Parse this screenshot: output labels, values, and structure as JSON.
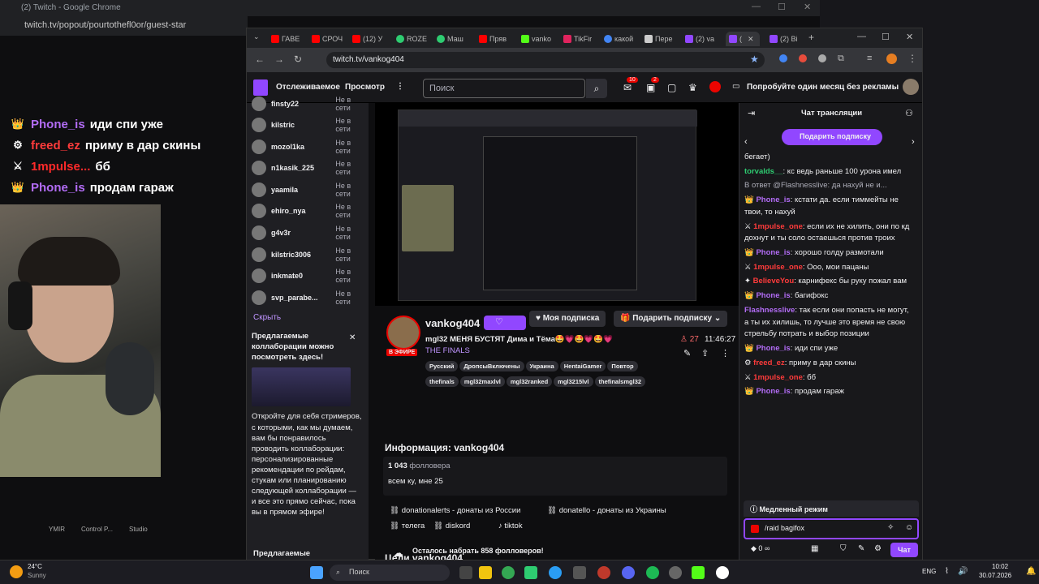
{
  "left_window": {
    "title": "(2) Twitch - Google Chrome",
    "url": "twitch.tv/popout/pourtothefl0or/guest-star"
  },
  "overlay_chat": [
    {
      "user": "Phone_is",
      "text": "иди спи уже",
      "color": "#b26cf5",
      "badge": "👑"
    },
    {
      "user": "freed_ez",
      "text": "приму в дар скины",
      "color": "#ff3b3b",
      "badge": "⚙"
    },
    {
      "user": "1mpulse...",
      "text": "бб",
      "color": "#ff2a2a",
      "badge": "⚔"
    },
    {
      "user": "Phone_is",
      "text": "продам гараж",
      "color": "#b26cf5",
      "badge": "👑"
    }
  ],
  "left_taskbar_labels": [
    "YMIR",
    "Control P...",
    "Studio"
  ],
  "chrome": {
    "tabs": [
      "ГАВЕ",
      "СРОЧ",
      "(12) У",
      "ROZE",
      "Маш",
      "Пряв",
      "vanko",
      "TikFir",
      "какой",
      "Пере",
      "(2) va",
      "(",
      "(2) Bi"
    ],
    "url": "twitch.tv/vankog404"
  },
  "twitch_nav": {
    "following": "Отслеживаемое",
    "browse": "Просмотр",
    "search_placeholder": "Поиск",
    "notif_count": "10",
    "whisper_count": "2",
    "promo": "Попробуйте один месяц без рекламы"
  },
  "sidebar": {
    "items": [
      {
        "name": "finsty22",
        "status": "Не в сети"
      },
      {
        "name": "kilstric",
        "status": "Не в сети"
      },
      {
        "name": "mozol1ka",
        "status": "Не в сети"
      },
      {
        "name": "n1kasik_225",
        "status": "Не в сети"
      },
      {
        "name": "yaamila",
        "status": "Не в сети"
      },
      {
        "name": "ehiro_nya",
        "status": "Не в сети"
      },
      {
        "name": "g4v3r",
        "status": "Не в сети"
      },
      {
        "name": "kilstric3006",
        "status": "Не в сети"
      },
      {
        "name": "inkmate0",
        "status": "Не в сети"
      },
      {
        "name": "svp_parabe...",
        "status": "Не в сети"
      }
    ],
    "hide": "Скрыть",
    "collab_title": "Предлагаемые коллаборации можно посмотреть здесь!",
    "collab_text": "Откройте для себя стримеров, с которыми, как мы думаем, вам бы понравилось проводить коллаборации: персонализированные рекомендации по рейдам, стукам или планированию следующей коллаборации — и все это прямо сейчас, пока вы в прямом эфире!",
    "bottom_label": "Предлагаемые"
  },
  "channel": {
    "live_badge": "В ЭФИРЕ",
    "name": "vankog404",
    "my_sub": "Моя подписка",
    "gift_sub": "Подарить подписку",
    "title": "mgl32 МЕНЯ БУСТЯТ Дима и Тёма🤩💗🤩💗🤩💗",
    "game": "THE FINALS",
    "viewers": "27",
    "uptime": "11:46:27",
    "tags": [
      "Русский",
      "ДропсыВключены",
      "Украина",
      "HentaiGamer",
      "Повтор",
      "thefinals",
      "mgl32maxlvl",
      "mgl32ranked",
      "mgl3215lvl",
      "thefinalsmgl32"
    ],
    "about_title": "Информация: vankog404",
    "followers_num": "1 043",
    "followers_label": "фолловера",
    "bio": "всем ку, мне 25",
    "links": [
      "donationalerts - донаты из России",
      "donatello - донаты из Украины",
      "телега",
      "diskord",
      "tiktok"
    ],
    "goals_title": "Цели vankog404",
    "goal_text": "Осталось набрать 858 фолловеров!"
  },
  "chat": {
    "header": "Чат трансляции",
    "gift_button": "Подарить подписку",
    "messages": [
      {
        "user": "",
        "text": "бегает)",
        "color": "#efeff1"
      },
      {
        "user": "torvalds__",
        "text": ": кс ведь раньше 100 урона имел",
        "color": "#2ecc71"
      },
      {
        "user": "",
        "text": "В ответ @Flashnesslive: да нахуй не и...",
        "color": "#adadb8"
      },
      {
        "user": "Phone_is",
        "text": ": кстати да. если тиммейты не твои, то нахуй",
        "color": "#b26cf5"
      },
      {
        "user": "1mpulse_one",
        "text": ": если их не хилить, они по кд дохнут и ты соло остаешься против троих",
        "color": "#ff3b3b"
      },
      {
        "user": "Phone_is",
        "text": ": хорошо голду размотали",
        "color": "#b26cf5"
      },
      {
        "user": "1mpulse_one",
        "text": ": Ооо, мои пацаны",
        "color": "#ff3b3b"
      },
      {
        "user": "BelieveYou",
        "text": ": карнифекс бы руку пожал вам",
        "color": "#ff3b3b"
      },
      {
        "user": "Phone_is",
        "text": ": багифокс",
        "color": "#b26cf5"
      },
      {
        "user": "Flashnesslive",
        "text": ": так если они попасть не могут, а ты их хилишь, то лучше это время не свою стрельбу потрать и выбор позиции",
        "color": "#b26cf5"
      },
      {
        "user": "Phone_is",
        "text": ": иди спи уже",
        "color": "#b26cf5"
      },
      {
        "user": "freed_ez",
        "text": ": приму в дар скины",
        "color": "#ff3b3b"
      },
      {
        "user": "1mpulse_one",
        "text": ": бб",
        "color": "#ff3b3b"
      },
      {
        "user": "Phone_is",
        "text": ": продам гараж",
        "color": "#b26cf5"
      }
    ],
    "slow_mode": "Медленный режим",
    "input_value": "/raid bagifox",
    "points": "0",
    "send": "Чат"
  },
  "taskbar": {
    "temp": "24°C",
    "weather": "Sunny",
    "search": "Поиск",
    "lang": "ENG",
    "time": "10:02",
    "date": "30.07.2026"
  }
}
